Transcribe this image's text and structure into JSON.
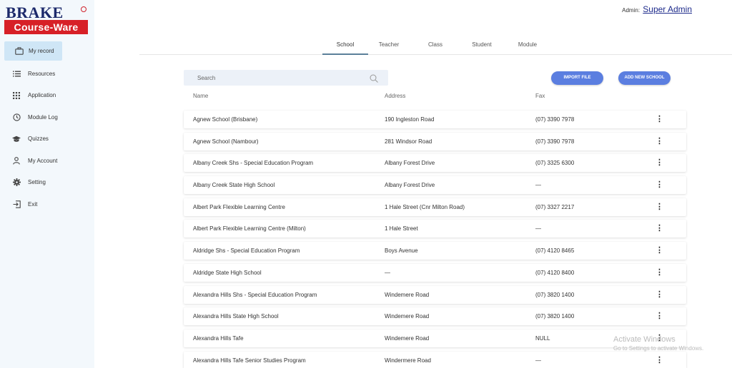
{
  "brand": {
    "line1": "BRAKE",
    "line2": "Course-Ware"
  },
  "sidebar": {
    "items": [
      {
        "label": "My record",
        "icon": "briefcase-icon",
        "active": true
      },
      {
        "label": "Resources",
        "icon": "list-icon"
      },
      {
        "label": "Application",
        "icon": "grid-icon"
      },
      {
        "label": "Module Log",
        "icon": "clock-icon"
      },
      {
        "label": "Quizzes",
        "icon": "graduation-cap-icon"
      },
      {
        "label": "My Account",
        "icon": "user-icon"
      },
      {
        "label": "Setting",
        "icon": "gear-icon"
      },
      {
        "label": "Exit",
        "icon": "exit-icon"
      }
    ]
  },
  "header": {
    "admin_label": "Admin:",
    "admin_name": "Super Admin"
  },
  "tabs": [
    "School",
    "Teacher",
    "Class",
    "Student",
    "Module"
  ],
  "search": {
    "placeholder": "Search"
  },
  "buttons": {
    "import": "IMPORT FILE",
    "add": "ADD NEW SCHOOL"
  },
  "table": {
    "headers": {
      "name": "Name",
      "address": "Address",
      "fax": "Fax"
    },
    "rows": [
      {
        "name": "Agnew School (Brisbane)",
        "address": "190 Ingleston Road",
        "fax": "(07) 3390 7978"
      },
      {
        "name": "Agnew School (Nambour)",
        "address": "281 Windsor Road",
        "fax": "(07) 3390 7978"
      },
      {
        "name": "Albany Creek Shs - Special Education Program",
        "address": "Albany Forest Drive",
        "fax": "(07) 3325 6300"
      },
      {
        "name": "Albany Creek State High School",
        "address": "Albany Forest Drive",
        "fax": "—"
      },
      {
        "name": "Albert Park Flexible Learning Centre",
        "address": "1 Hale Street (Cnr Milton Road)",
        "fax": "(07) 3327 2217"
      },
      {
        "name": "Albert Park Flexible Learning Centre (Milton)",
        "address": "1 Hale Street",
        "fax": "—"
      },
      {
        "name": "Aldridge Shs - Special Education Program",
        "address": "Boys Avenue",
        "fax": "(07) 4120 8465"
      },
      {
        "name": "Aldridge State High School",
        "address": "—",
        "fax": "(07) 4120 8400"
      },
      {
        "name": "Alexandra Hills Shs - Special Education Program",
        "address": "Windemere Road",
        "fax": "(07) 3820 1400"
      },
      {
        "name": "Alexandra Hills State High School",
        "address": "Windemere Road",
        "fax": "(07) 3820 1400"
      },
      {
        "name": "Alexandra Hills Tafe",
        "address": "Windemere Road",
        "fax": "NULL"
      },
      {
        "name": "Alexandra Hills Tafe Senior Studies Program",
        "address": "Windermere Road",
        "fax": "—"
      }
    ],
    "menu_glyph": "⋮"
  },
  "watermark": {
    "line1": "Activate Windows",
    "line2": "Go to Settings to activate Windows."
  },
  "colors": {
    "accent": "#5b7ee0",
    "sidebar_bg": "#f3f8fc",
    "active_item": "#cfe6f6",
    "brand_red": "#d72027",
    "brand_navy": "#1d2a6b"
  }
}
